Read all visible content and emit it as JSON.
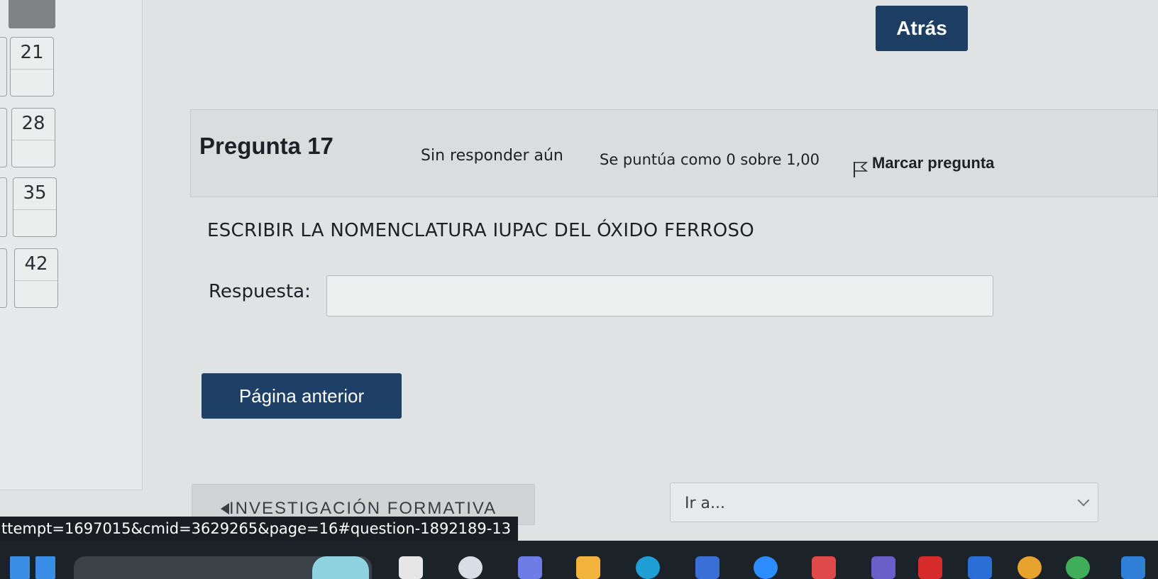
{
  "nav": {
    "question_numbers": [
      "21",
      "28",
      "35",
      "42"
    ]
  },
  "header": {
    "back_label": "Atrás"
  },
  "question": {
    "title": "Pregunta 17",
    "status": "Sin responder aún",
    "grade": "Se puntúa como 0 sobre 1,00",
    "flag_label": "Marcar pregunta",
    "text": "ESCRIBIR LA NOMENCLATURA IUPAC DEL ÓXIDO FERROSO",
    "answer_label": "Respuesta:",
    "answer_value": ""
  },
  "footer": {
    "prev_page_label": "Página anterior",
    "activity_link": "INVESTIGACIÓN FORMATIVA",
    "jump_placeholder": "Ir a..."
  },
  "status_bar": {
    "url": "ttempt=1697015&cmid=3629265&page=16#question-1892189-13"
  },
  "taskbar": {
    "icons": [
      "windows-icon",
      "search-box",
      "copilot-icon",
      "file-explorer-icon",
      "edge-icon",
      "store-icon",
      "zoom-icon",
      "camera-icon",
      "app-icon",
      "youtube-icon",
      "word-icon",
      "chrome-icon",
      "chrome-alt-icon",
      "app-icon-2"
    ]
  },
  "colors": {
    "primary_button": "#1c3e63",
    "background": "#dfe3e3"
  }
}
